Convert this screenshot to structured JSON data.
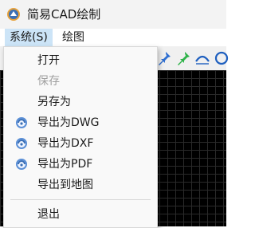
{
  "window": {
    "title": "简易CAD绘制"
  },
  "menubar": {
    "items": [
      {
        "label": "系统(S)",
        "active": true
      },
      {
        "label": "绘图",
        "active": false
      }
    ]
  },
  "system_menu": {
    "items": [
      {
        "label": "打开",
        "enabled": true,
        "icon": null
      },
      {
        "label": "保存",
        "enabled": false,
        "icon": null
      },
      {
        "label": "另存为",
        "enabled": true,
        "icon": null
      },
      {
        "label": "导出为DWG",
        "enabled": true,
        "icon": "export-gear-icon"
      },
      {
        "label": "导出为DXF",
        "enabled": true,
        "icon": "export-gear-icon"
      },
      {
        "label": "导出为PDF",
        "enabled": true,
        "icon": "export-gear-icon"
      },
      {
        "label": "导出到地图",
        "enabled": true,
        "icon": null
      },
      {
        "label": "退出",
        "enabled": true,
        "icon": null
      }
    ]
  },
  "toolbar": {
    "icons": [
      "blue-pushpin-icon",
      "green-pushpin-icon",
      "arc-icon",
      "circle-icon"
    ]
  },
  "colors": {
    "menu_highlight": "#cce4f7",
    "canvas_bg": "#000000",
    "disabled_text": "#a0a0a0"
  }
}
